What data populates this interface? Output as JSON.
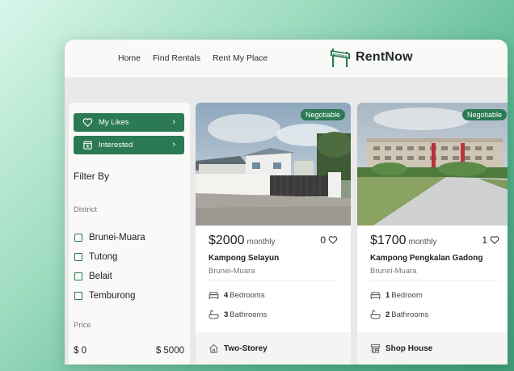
{
  "nav": {
    "items": [
      "Home",
      "Find Rentals",
      "Rent My Place"
    ]
  },
  "brand": {
    "name": "RentNow",
    "sign_text": "RENTNOW",
    "color": "#2c7a54"
  },
  "sidebar": {
    "likes_label": "My Likes",
    "interested_label": "Interested",
    "filter_title": "Filter By",
    "district_label": "District",
    "districts": [
      "Brunei-Muara",
      "Tutong",
      "Belait",
      "Temburong"
    ],
    "price_label": "Price",
    "price_min": "$ 0",
    "price_max": "$ 5000"
  },
  "listings": [
    {
      "badge": "Negotiable",
      "price": "$2000",
      "period": "monthly",
      "likes": "0",
      "title": "Kampong Selayun",
      "district": "Brunei-Muara",
      "bedrooms_count": "4",
      "bedrooms_label": "Bedrooms",
      "bathrooms_count": "3",
      "bathrooms_label": "Bathrooms",
      "property_type": "Two-Storey",
      "type_icon": "house-icon"
    },
    {
      "badge": "Negotiable",
      "price": "$1700",
      "period": "monthly",
      "likes": "1",
      "title": "Kampong Pengkalan Gadong",
      "district": "Brunei-Muara",
      "bedrooms_count": "1",
      "bedrooms_label": "Bedroom",
      "bathrooms_count": "2",
      "bathrooms_label": "Bathrooms",
      "property_type": "Shop House",
      "type_icon": "shop-icon"
    }
  ]
}
